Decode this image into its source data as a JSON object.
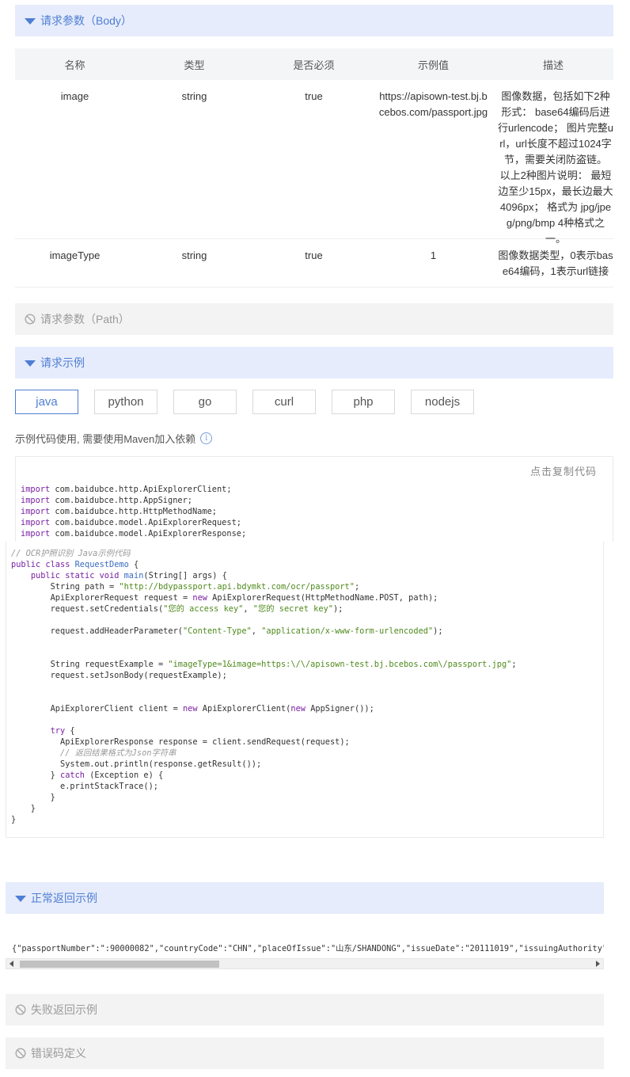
{
  "sections": {
    "body_params": "请求参数（Body）",
    "path_params": "请求参数（Path）",
    "request_example": "请求示例",
    "normal_response": "正常返回示例",
    "failed_response": "失败返回示例",
    "error_codes": "错误码定义"
  },
  "params_table": {
    "headers": [
      "名称",
      "类型",
      "是否必须",
      "示例值",
      "描述"
    ],
    "rows": [
      {
        "name": "image",
        "type": "string",
        "required": "true",
        "example": "https://apisown-test.bj.bcebos.com/passport.jpg",
        "description": "图像数据，包括如下2种形式： base64编码后进行urlencode； 图片完整url，url长度不超过1024字节，需要关闭防盗链。 以上2种图片说明： 最短边至少15px，最长边最大4096px； 格式为 jpg/jpeg/png/bmp 4种格式之一。"
      },
      {
        "name": "imageType",
        "type": "string",
        "required": "true",
        "example": "1",
        "description": "图像数据类型，0表示base64编码，1表示url链接"
      }
    ]
  },
  "language_tabs": [
    "java",
    "python",
    "go",
    "curl",
    "php",
    "nodejs"
  ],
  "active_tab": "java",
  "maven_note": "示例代码使用, 需要使用Maven加入依赖",
  "copy_code_label": "点击复制代码",
  "code": {
    "imports": [
      "com.baidubce.http.ApiExplorerClient;",
      "com.baidubce.http.AppSigner;",
      "com.baidubce.http.HttpMethodName;",
      "com.baidubce.model.ApiExplorerRequest;",
      "com.baidubce.model.ApiExplorerResponse;"
    ],
    "comment_title": "// OCR护照识别 Java示例代码",
    "class_name": "RequestDemo",
    "path_url": "\"http://bdypassport.api.bdymkt.com/ocr/passport\"",
    "access_key": "\"您的 access key\"",
    "secret_key": "\"您的 secret key\"",
    "content_type_key": "\"Content-Type\"",
    "content_type_value": "\"application/x-www-form-urlencoded\"",
    "request_example": "\"imageType=1&image=https:\\/\\/apisown-test.bj.bcebos.com\\/passport.jpg\"",
    "json_comment": "// 返回结果格式为Json字符串"
  },
  "response_sample": "{\"passportNumber\":\":90000082\",\"countryCode\":\"CHN\",\"placeOfIssue\":\"山东/SHANDONG\",\"issueDate\":\"20111019\",\"issuingAuthority\":\"公安部出入境管理局",
  "colors": {
    "accent": "#4f7ed3",
    "active_header_bg": "#e6ecfb",
    "disabled_header_bg": "#f3f3f3",
    "keyword": "#7a1fa2",
    "string": "#4f8a1d"
  }
}
